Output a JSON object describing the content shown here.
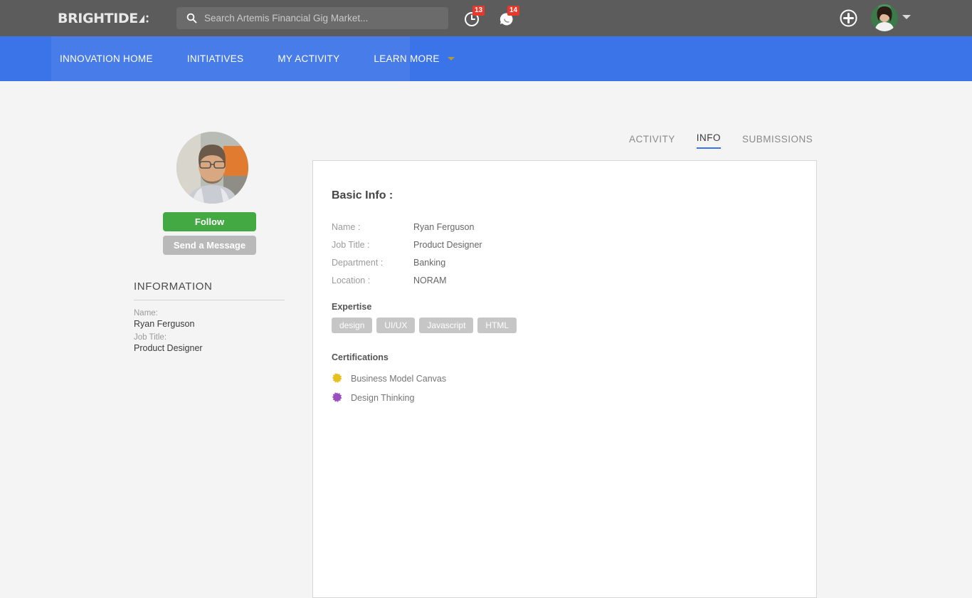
{
  "header": {
    "logo_text": "BRIGHTIDE",
    "logo_icon": "brightidea-triangle-mark",
    "search": {
      "placeholder": "Search Artemis Financial Gig Market...",
      "value": "",
      "icon": "search-icon"
    },
    "notifications": [
      {
        "icon": "clock-icon",
        "count": "13"
      },
      {
        "icon": "chat-bubble-icon",
        "count": "14"
      }
    ],
    "add_icon": "plus-circle-icon",
    "avatar_icon": "user-avatar",
    "caret_icon": "chevron-down-icon",
    "bg_color": "#5c5c5c"
  },
  "nav": {
    "accent_color": "#3b73e8",
    "items": [
      {
        "label": "INNOVATION HOME"
      },
      {
        "label": "INITIATIVES"
      },
      {
        "label": "MY ACTIVITY"
      },
      {
        "label": "LEARN MORE",
        "caret": "chevron-down-icon"
      }
    ]
  },
  "sidebar": {
    "avatar_icon": "profile-photo",
    "follow_label": "Follow",
    "message_label": "Send a Message",
    "follow_color": "#43a943",
    "message_color": "#b9b9b9",
    "section_title": "INFORMATION",
    "fields": [
      {
        "label": "Name:",
        "value": "Ryan Ferguson"
      },
      {
        "label": "Job Title:",
        "value": "Product Designer"
      }
    ]
  },
  "tabs": [
    {
      "label": "ACTIVITY",
      "active": false
    },
    {
      "label": "INFO",
      "active": true
    },
    {
      "label": "SUBMISSIONS",
      "active": false
    }
  ],
  "main": {
    "card_title": "Basic Info :",
    "basic_info": [
      {
        "key": "Name :",
        "value": "Ryan Ferguson"
      },
      {
        "key": "Job Title :",
        "value": "Product Designer"
      },
      {
        "key": "Department :",
        "value": "Banking"
      },
      {
        "key": "Location :",
        "value": "NORAM"
      }
    ],
    "expertise_title": "Expertise",
    "expertise_tags": [
      "design",
      "UI/UX",
      "Javascript",
      "HTML"
    ],
    "certifications_title": "Certifications",
    "certifications": [
      {
        "name": "Business Model Canvas",
        "badge_color": "#e5c021",
        "icon": "badge-starburst-icon"
      },
      {
        "name": "Design Thinking",
        "badge_color": "#9b4fbf",
        "icon": "badge-starburst-icon"
      }
    ]
  }
}
